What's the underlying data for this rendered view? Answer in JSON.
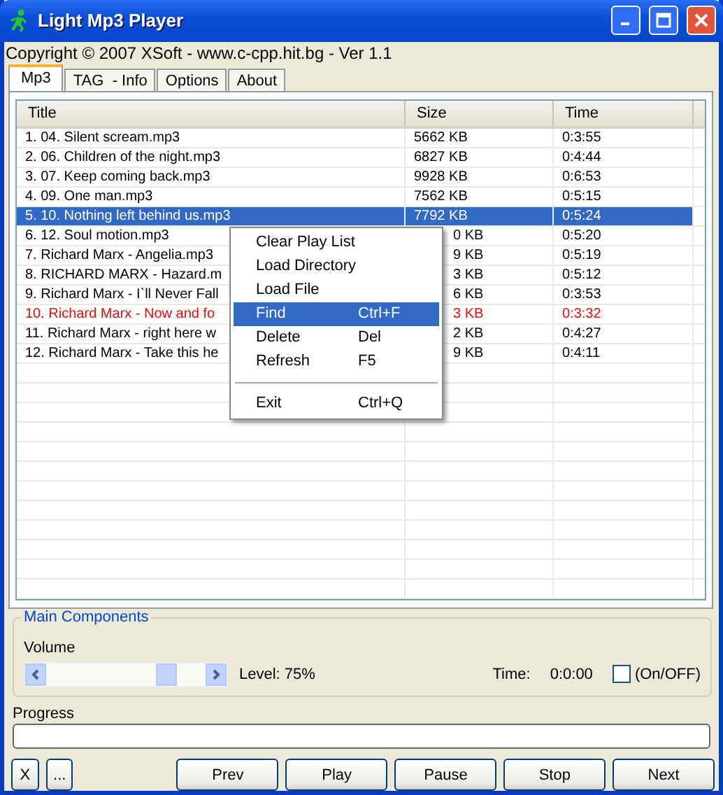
{
  "window": {
    "title": "Light Mp3 Player"
  },
  "copyright": "Copyright © 2007 XSoft - www.c-cpp.hit.bg - Ver 1.1",
  "tabs": [
    {
      "label": "Mp3",
      "selected": true
    },
    {
      "label": "TAG  - Info",
      "selected": false
    },
    {
      "label": "Options",
      "selected": false
    },
    {
      "label": "About",
      "selected": false
    }
  ],
  "table": {
    "columns": [
      "Title",
      "Size",
      "Time"
    ],
    "rows": [
      {
        "title": "1. 04. Silent scream.mp3",
        "size": "5662 KB",
        "time": "0:3:55",
        "selected": false,
        "playing": false
      },
      {
        "title": "2. 06. Children of the night.mp3",
        "size": "6827 KB",
        "time": "0:4:44",
        "selected": false,
        "playing": false
      },
      {
        "title": "3. 07. Keep coming back.mp3",
        "size": "9928 KB",
        "time": "0:6:53",
        "selected": false,
        "playing": false
      },
      {
        "title": "4. 09. One man.mp3",
        "size": "7562 KB",
        "time": "0:5:15",
        "selected": false,
        "playing": false
      },
      {
        "title": "5. 10. Nothing left behind us.mp3",
        "size": "7792 KB",
        "time": "0:5:24",
        "selected": true,
        "playing": false
      },
      {
        "title": "6. 12. Soul motion.mp3",
        "size": "0 KB",
        "time": "0:5:20",
        "selected": false,
        "playing": false
      },
      {
        "title": "7. Richard Marx - Angelia.mp3",
        "size": "9 KB",
        "time": "0:5:19",
        "selected": false,
        "playing": false
      },
      {
        "title": "8. RICHARD MARX - Hazard.m",
        "size": "3 KB",
        "time": "0:5:12",
        "selected": false,
        "playing": false
      },
      {
        "title": "9. Richard Marx - I`ll Never Fall",
        "size": "6 KB",
        "time": "0:3:53",
        "selected": false,
        "playing": false
      },
      {
        "title": "10. Richard Marx - Now and fo",
        "size": "3 KB",
        "time": "0:3:32",
        "selected": false,
        "playing": true
      },
      {
        "title": "11. Richard Marx - right here w",
        "size": "2 KB",
        "time": "0:4:27",
        "selected": false,
        "playing": false
      },
      {
        "title": "12. Richard Marx - Take this he",
        "size": "9 KB",
        "time": "0:4:11",
        "selected": false,
        "playing": false
      }
    ]
  },
  "context_menu": {
    "items": [
      {
        "kind": "item",
        "label": "Clear Play List",
        "selected": false
      },
      {
        "kind": "item",
        "label": "Load Directory",
        "selected": false
      },
      {
        "kind": "item",
        "label": "Load File",
        "selected": false
      },
      {
        "kind": "item",
        "label": "Find",
        "shortcut": "Ctrl+F",
        "selected": true
      },
      {
        "kind": "item",
        "label": "Delete",
        "shortcut": "Del",
        "selected": false
      },
      {
        "kind": "item",
        "label": "Refresh",
        "shortcut": "F5",
        "selected": false
      },
      {
        "kind": "separator"
      },
      {
        "kind": "item",
        "label": "Exit",
        "shortcut": "Ctrl+Q",
        "selected": false
      }
    ]
  },
  "main_components": {
    "title": "Main Components",
    "volume_label": "Volume",
    "volume": {
      "level": 0.75
    },
    "level_text": "Level: 75%",
    "time_label": "Time:",
    "time": "0:0:00",
    "toggle": {
      "label": "(On/OFF)",
      "checked": false
    }
  },
  "progress": {
    "label": "Progress",
    "level": 0
  },
  "buttons": [
    {
      "kind": "small",
      "label": "X"
    },
    {
      "kind": "small",
      "label": "..."
    },
    {
      "kind": "wide",
      "label": "Prev"
    },
    {
      "kind": "wide",
      "label": "Play"
    },
    {
      "kind": "wide",
      "label": "Pause"
    },
    {
      "kind": "wide",
      "label": "Stop"
    },
    {
      "kind": "wide",
      "label": "Next"
    }
  ]
}
